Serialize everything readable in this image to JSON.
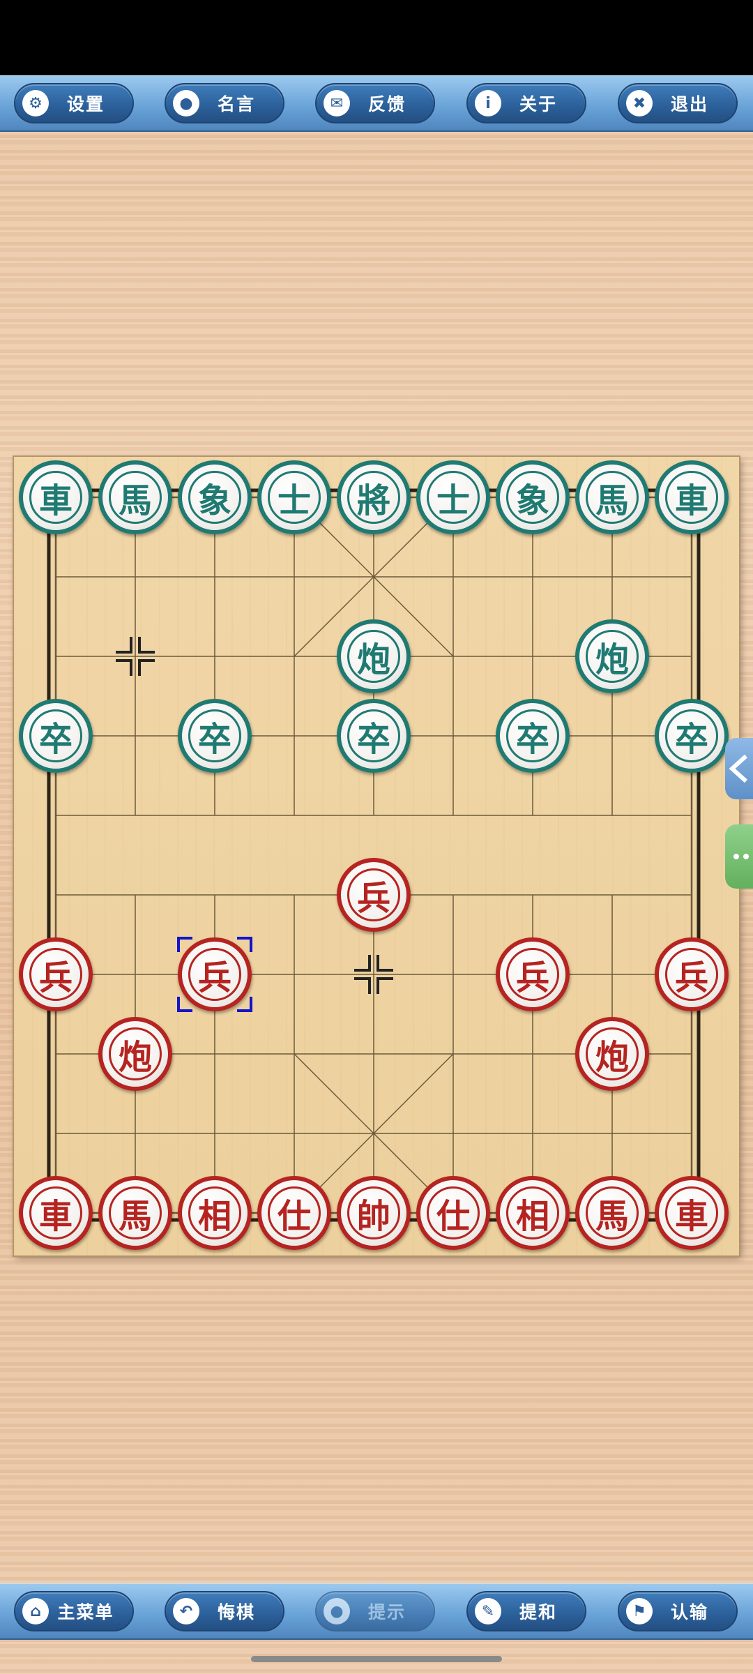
{
  "top_menu": [
    {
      "label": "设置",
      "icon": "gear-icon",
      "glyph": "⚙"
    },
    {
      "label": "名言",
      "icon": "speech-bubble-icon",
      "glyph": "●"
    },
    {
      "label": "反馈",
      "icon": "envelope-icon",
      "glyph": "✉"
    },
    {
      "label": "关于",
      "icon": "info-icon",
      "glyph": "i"
    },
    {
      "label": "退出",
      "icon": "close-icon",
      "glyph": "✖"
    }
  ],
  "bottom_menu": [
    {
      "label": "主菜单",
      "icon": "home-icon",
      "glyph": "⌂",
      "enabled": true
    },
    {
      "label": "悔棋",
      "icon": "undo-icon",
      "glyph": "↶",
      "enabled": true
    },
    {
      "label": "提示",
      "icon": "hint-icon",
      "glyph": "●",
      "enabled": false
    },
    {
      "label": "提和",
      "icon": "pencil-icon",
      "glyph": "✎",
      "enabled": true
    },
    {
      "label": "认输",
      "icon": "flag-icon",
      "glyph": "⚑",
      "enabled": true
    }
  ],
  "board": {
    "files": 9,
    "ranks": 10,
    "selected": {
      "file": 2,
      "rank": 6
    },
    "pieces": [
      {
        "side": "black",
        "char": "車",
        "file": 0,
        "rank": 0
      },
      {
        "side": "black",
        "char": "馬",
        "file": 1,
        "rank": 0
      },
      {
        "side": "black",
        "char": "象",
        "file": 2,
        "rank": 0
      },
      {
        "side": "black",
        "char": "士",
        "file": 3,
        "rank": 0
      },
      {
        "side": "black",
        "char": "將",
        "file": 4,
        "rank": 0
      },
      {
        "side": "black",
        "char": "士",
        "file": 5,
        "rank": 0
      },
      {
        "side": "black",
        "char": "象",
        "file": 6,
        "rank": 0
      },
      {
        "side": "black",
        "char": "馬",
        "file": 7,
        "rank": 0
      },
      {
        "side": "black",
        "char": "車",
        "file": 8,
        "rank": 0
      },
      {
        "side": "black",
        "char": "炮",
        "file": 4,
        "rank": 2
      },
      {
        "side": "black",
        "char": "炮",
        "file": 7,
        "rank": 2
      },
      {
        "side": "black",
        "char": "卒",
        "file": 0,
        "rank": 3
      },
      {
        "side": "black",
        "char": "卒",
        "file": 2,
        "rank": 3
      },
      {
        "side": "black",
        "char": "卒",
        "file": 4,
        "rank": 3
      },
      {
        "side": "black",
        "char": "卒",
        "file": 6,
        "rank": 3
      },
      {
        "side": "black",
        "char": "卒",
        "file": 8,
        "rank": 3
      },
      {
        "side": "red",
        "char": "兵",
        "file": 4,
        "rank": 5
      },
      {
        "side": "red",
        "char": "兵",
        "file": 0,
        "rank": 6
      },
      {
        "side": "red",
        "char": "兵",
        "file": 2,
        "rank": 6
      },
      {
        "side": "red",
        "char": "兵",
        "file": 6,
        "rank": 6
      },
      {
        "side": "red",
        "char": "兵",
        "file": 8,
        "rank": 6
      },
      {
        "side": "red",
        "char": "炮",
        "file": 1,
        "rank": 7
      },
      {
        "side": "red",
        "char": "炮",
        "file": 7,
        "rank": 7
      },
      {
        "side": "red",
        "char": "車",
        "file": 0,
        "rank": 9
      },
      {
        "side": "red",
        "char": "馬",
        "file": 1,
        "rank": 9
      },
      {
        "side": "red",
        "char": "相",
        "file": 2,
        "rank": 9
      },
      {
        "side": "red",
        "char": "仕",
        "file": 3,
        "rank": 9
      },
      {
        "side": "red",
        "char": "帥",
        "file": 4,
        "rank": 9
      },
      {
        "side": "red",
        "char": "仕",
        "file": 5,
        "rank": 9
      },
      {
        "side": "red",
        "char": "相",
        "file": 6,
        "rank": 9
      },
      {
        "side": "red",
        "char": "馬",
        "file": 7,
        "rank": 9
      },
      {
        "side": "red",
        "char": "車",
        "file": 8,
        "rank": 9
      }
    ],
    "markers": [
      {
        "file": 1,
        "rank": 2
      },
      {
        "file": 4,
        "rank": 6
      }
    ]
  },
  "colors": {
    "black_piece": "#1f7a72",
    "red_piece": "#b52420",
    "grid": "#6b5a3a",
    "selection": "#1414c8"
  }
}
